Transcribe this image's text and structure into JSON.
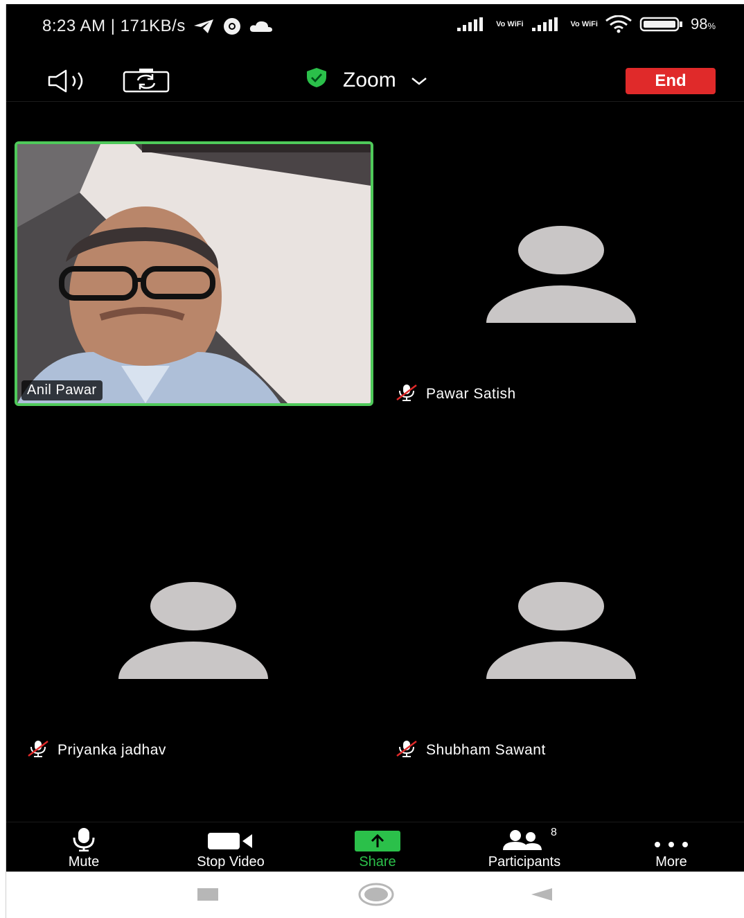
{
  "status_bar": {
    "time_speed": "8:23 AM | 171KB/s",
    "vowifi_1": "Vo WiFi",
    "vowifi_2": "Vo WiFi",
    "battery": "98",
    "battery_unit": "%"
  },
  "toolbar": {
    "app_title": "Zoom",
    "end_label": "End",
    "speaker_icon": "speaker-icon",
    "camera_switch_icon": "camera-switch-icon",
    "security_icon": "shield-check-icon"
  },
  "participants_grid": [
    {
      "name": "Anil Pawar",
      "video_on": true,
      "active_speaker": true
    },
    {
      "name": "Pawar Satish",
      "video_on": false,
      "muted": true
    },
    {
      "name": "Priyanka jadhav",
      "video_on": false,
      "muted": true
    },
    {
      "name": "Shubham Sawant",
      "video_on": false,
      "muted": true
    }
  ],
  "bottom_bar": {
    "mute_label": "Mute",
    "stop_video_label": "Stop Video",
    "share_label": "Share",
    "participants_label": "Participants",
    "participants_count": "8",
    "more_label": "More"
  },
  "colors": {
    "active_speaker_border": "#4fc95a",
    "end_button": "#e02a2a",
    "share_accent": "#2bc04a",
    "avatar": "#c9c6c6"
  }
}
